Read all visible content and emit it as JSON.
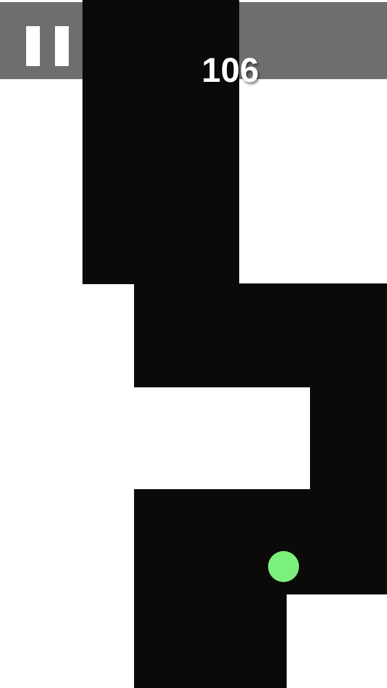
{
  "game": {
    "score": "106",
    "colors": {
      "background": "#ffffff",
      "path": "#0c0a08",
      "topbar": "#6e6e6e",
      "ball": "#7cf07c",
      "score_text": "#ffffff"
    },
    "pause_icon": "pause-icon"
  }
}
